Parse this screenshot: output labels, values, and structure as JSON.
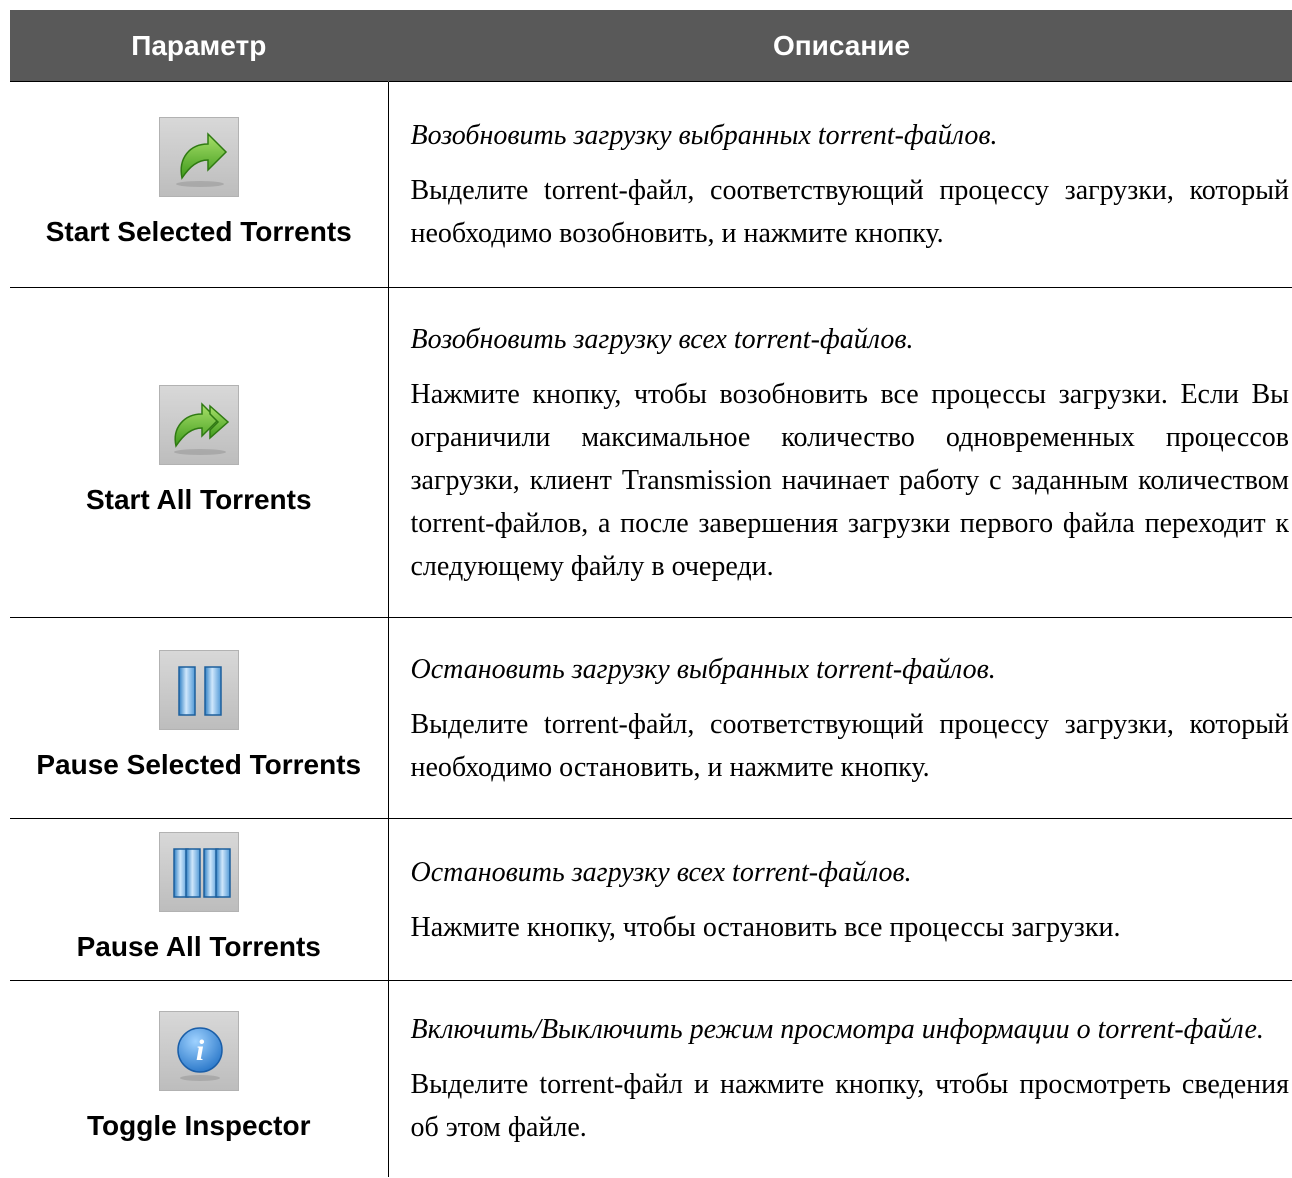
{
  "table": {
    "headers": {
      "param": "Параметр",
      "description": "Описание"
    },
    "rows": [
      {
        "icon": "start-selected-icon",
        "name": "Start Selected Torrents",
        "summary": "Возобновить загрузку выбранных torrent-файлов.",
        "detail": "Выделите torrent-файл, соответствующий процессу загрузки, который необходимо возобновить, и нажмите кнопку."
      },
      {
        "icon": "start-all-icon",
        "name": "Start All Torrents",
        "summary": "Возобновить загрузку всех torrent-файлов.",
        "detail": "Нажмите кнопку, чтобы возобновить все процессы загрузки. Если Вы ограничили максимальное количество одновременных процессов загрузки, клиент Transmission начинает работу с заданным количеством torrent-файлов, а после завершения загрузки первого файла переходит к следующему файлу в очереди."
      },
      {
        "icon": "pause-selected-icon",
        "name": "Pause Selected Torrents",
        "summary": "Остановить загрузку выбранных torrent-файлов.",
        "detail": "Выделите torrent-файл, соответствующий процессу загрузки, который необходимо остановить, и нажмите кнопку."
      },
      {
        "icon": "pause-all-icon",
        "name": "Pause All Torrents",
        "summary": "Остановить загрузку всех torrent-файлов.",
        "detail": "Нажмите кнопку, чтобы остановить все процессы загрузки."
      },
      {
        "icon": "info-icon",
        "name": "Toggle Inspector",
        "summary": "Включить/Выключить режим просмотра информации о torrent-файле.",
        "detail": "Выделите torrent-файл и нажмите кнопку, чтобы просмотреть сведения об этом файле."
      }
    ]
  }
}
